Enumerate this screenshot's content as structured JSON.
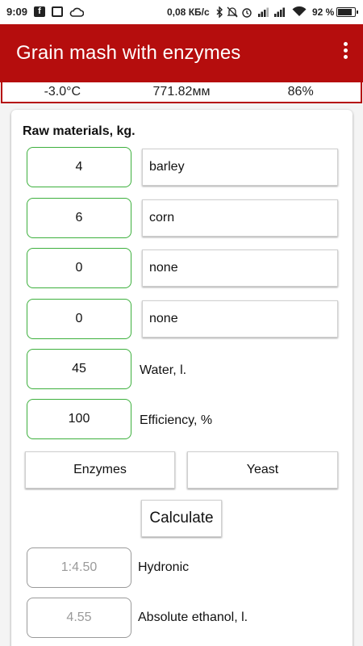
{
  "status_bar": {
    "time": "9:09",
    "speed": "0,08 КБ/с",
    "battery_text": "92 %",
    "battery_level": 0.92,
    "icons": [
      "facebook-icon",
      "notification-icon",
      "cloud-icon",
      "bluetooth-icon",
      "mute-icon",
      "alarm-icon",
      "signal-icon",
      "wifi-icon",
      "battery-icon"
    ]
  },
  "app_bar": {
    "title": "Grain mash with enzymes",
    "menu_icon": "more-vert-icon"
  },
  "conditions": {
    "temperature": "-3.0°C",
    "pressure": "771.82мм",
    "humidity": "86%"
  },
  "raw_materials": {
    "title": "Raw materials, kg.",
    "rows": [
      {
        "amount": "4",
        "name": "barley"
      },
      {
        "amount": "6",
        "name": "corn"
      },
      {
        "amount": "0",
        "name": "none"
      },
      {
        "amount": "0",
        "name": "none"
      }
    ]
  },
  "water": {
    "value": "45",
    "label": "Water, l."
  },
  "efficiency": {
    "value": "100",
    "label": "Efficiency, %"
  },
  "buttons": {
    "enzymes": "Enzymes",
    "yeast": "Yeast",
    "calculate": "Calculate"
  },
  "results": {
    "hydronic": {
      "value": "1:4.50",
      "label": "Hydronic"
    },
    "ethanol": {
      "value": "4.55",
      "label": "Absolute ethanol, l."
    }
  },
  "colors": {
    "accent": "#b50d0d",
    "input_border": "#3db03d",
    "output_border": "#9a9a9a"
  }
}
